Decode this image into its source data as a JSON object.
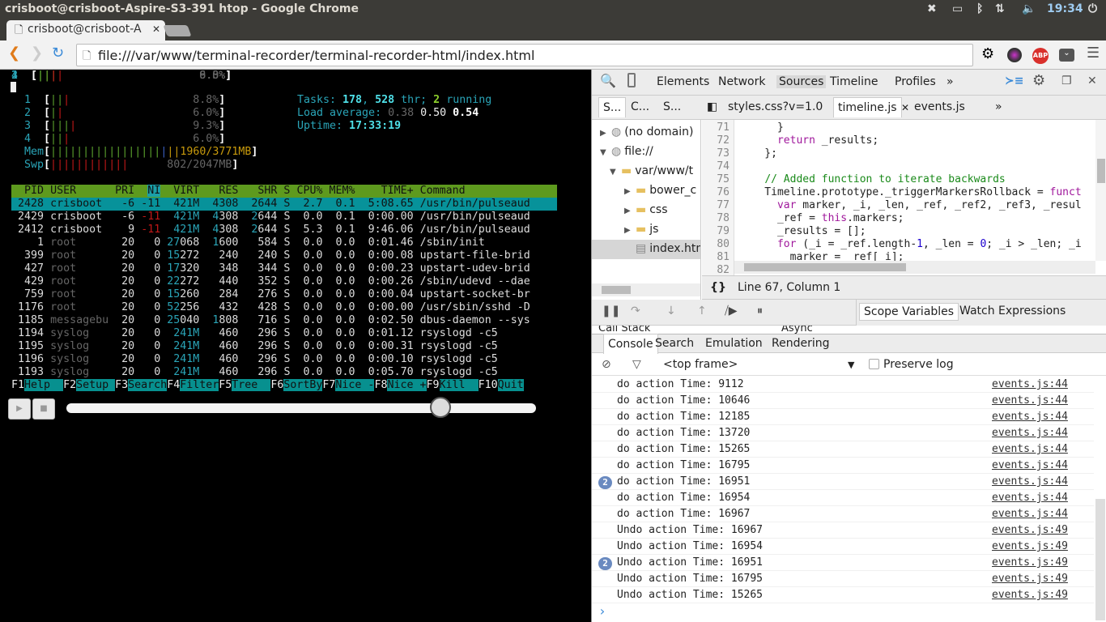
{
  "window": {
    "title": "crisboot@crisboot-Aspire-S3-391 htop - Google Chrome",
    "clock": "19:34"
  },
  "browser": {
    "tab_title": "crisboot@crisboot-A",
    "url": "file:///var/www/terminal-recorder/terminal-recorder-html/index.html",
    "abp": "ABP"
  },
  "htop": {
    "cpus": [
      {
        "label": "1",
        "bars": [
          "gr",
          "gr",
          "rd"
        ],
        "value": "8.8%"
      },
      {
        "label": "2",
        "bars": [
          "gr",
          "rd"
        ],
        "value": "6.0%"
      },
      {
        "label": "3",
        "bars": [
          "gr",
          "gr",
          "gr",
          "rd"
        ],
        "value": "9.3%"
      },
      {
        "label": "4",
        "bars": [
          "gr",
          "gr",
          "rd"
        ],
        "value": "6.0%"
      }
    ],
    "mem": {
      "label": "Mem",
      "bars": [
        "gr",
        "gr",
        "gr",
        "gr",
        "gr",
        "gr",
        "gr",
        "gr",
        "gr",
        "gr",
        "gr",
        "gr",
        "gr",
        "gr",
        "gr",
        "gr",
        "gr",
        "bl",
        "yl",
        "yl"
      ],
      "value": "1960/3771MB"
    },
    "swp": {
      "label": "Swp",
      "bars": [
        "rd",
        "rd",
        "rd",
        "rd",
        "rd",
        "rd",
        "rd",
        "rd",
        "rd",
        "rd",
        "rd",
        "rd"
      ],
      "value": "802/2047MB"
    },
    "tasks": {
      "label": "Tasks: ",
      "tasks": "178",
      "thr": "528",
      "thr_label": " thr; ",
      "running": "2",
      "running_label": " running"
    },
    "load": {
      "label": "Load average: ",
      "l1": "0.38",
      "l5": "0.50",
      "l15": "0.54"
    },
    "uptime": {
      "label": "Uptime: ",
      "value": "17:33:19"
    },
    "columns": [
      "PID",
      "USER",
      "PRI",
      "NI",
      "VIRT",
      "RES",
      "SHR",
      "S",
      "CPU%",
      "MEM%",
      "TIME+",
      "Command"
    ],
    "processes": [
      [
        "2428",
        "crisboot",
        "-6",
        "-11",
        "421M",
        "4308",
        "2644",
        "S",
        "2.7",
        "0.1",
        "5:08.65",
        "/usr/bin/pulseaud"
      ],
      [
        "2429",
        "crisboot",
        "-6",
        "-11",
        "421M",
        "4308",
        "2644",
        "S",
        "0.0",
        "0.1",
        "0:00.00",
        "/usr/bin/pulseaud"
      ],
      [
        "2412",
        "crisboot",
        "9",
        "-11",
        "421M",
        "4308",
        "2644",
        "S",
        "5.3",
        "0.1",
        "9:46.06",
        "/usr/bin/pulseaud"
      ],
      [
        "1",
        "root",
        "20",
        "0",
        "27068",
        "1600",
        "584",
        "S",
        "0.0",
        "0.0",
        "0:01.46",
        "/sbin/init"
      ],
      [
        "399",
        "root",
        "20",
        "0",
        "15272",
        "240",
        "240",
        "S",
        "0.0",
        "0.0",
        "0:00.08",
        "upstart-file-brid"
      ],
      [
        "427",
        "root",
        "20",
        "0",
        "17320",
        "348",
        "344",
        "S",
        "0.0",
        "0.0",
        "0:00.23",
        "upstart-udev-brid"
      ],
      [
        "429",
        "root",
        "20",
        "0",
        "22272",
        "440",
        "352",
        "S",
        "0.0",
        "0.0",
        "0:00.26",
        "/sbin/udevd --dae"
      ],
      [
        "759",
        "root",
        "20",
        "0",
        "15260",
        "284",
        "276",
        "S",
        "0.0",
        "0.0",
        "0:00.04",
        "upstart-socket-br"
      ],
      [
        "1176",
        "root",
        "20",
        "0",
        "52256",
        "432",
        "428",
        "S",
        "0.0",
        "0.0",
        "0:00.00",
        "/usr/sbin/sshd -D"
      ],
      [
        "1185",
        "messagebu",
        "20",
        "0",
        "25040",
        "1808",
        "716",
        "S",
        "0.0",
        "0.0",
        "0:02.50",
        "dbus-daemon --sys"
      ],
      [
        "1194",
        "syslog",
        "20",
        "0",
        "241M",
        "460",
        "296",
        "S",
        "0.0",
        "0.0",
        "0:01.12",
        "rsyslogd -c5"
      ],
      [
        "1195",
        "syslog",
        "20",
        "0",
        "241M",
        "460",
        "296",
        "S",
        "0.0",
        "0.0",
        "0:00.31",
        "rsyslogd -c5"
      ],
      [
        "1196",
        "syslog",
        "20",
        "0",
        "241M",
        "460",
        "296",
        "S",
        "0.0",
        "0.0",
        "0:00.10",
        "rsyslogd -c5"
      ],
      [
        "1193",
        "syslog",
        "20",
        "0",
        "241M",
        "460",
        "296",
        "S",
        "0.0",
        "0.0",
        "0:05.70",
        "rsyslogd -c5"
      ]
    ],
    "selected_row": 0,
    "fkeys": [
      [
        "F1",
        "Help  "
      ],
      [
        "F2",
        "Setup "
      ],
      [
        "F3",
        "Search"
      ],
      [
        "F4",
        "Filter"
      ],
      [
        "F5",
        "Tree  "
      ],
      [
        "F6",
        "SortBy"
      ],
      [
        "F7",
        "Nice -"
      ],
      [
        "F8",
        "Nice +"
      ],
      [
        "F9",
        "Kill  "
      ],
      [
        "F10",
        "Quit"
      ]
    ]
  },
  "player": {
    "play": "▶",
    "stop": "■",
    "progress_percent": 81
  },
  "devtools": {
    "tabs": [
      "Elements",
      "Network",
      "Sources",
      "Timeline",
      "Profiles",
      "»"
    ],
    "active_tab": "Sources",
    "nav_tabs": [
      "S...",
      "C...",
      "S..."
    ],
    "file_tabs": [
      "styles.css?v=1.0",
      "timeline.js",
      "events.js",
      "»"
    ],
    "tree": [
      "(no domain)",
      "file://",
      "var/www/t",
      "bower_c",
      "css",
      "js",
      "index.htm"
    ],
    "code": [
      {
        "n": "71",
        "h": "      }"
      },
      {
        "n": "72",
        "h": "      <span class='kw'>return</span> _results;"
      },
      {
        "n": "73",
        "h": "    };"
      },
      {
        "n": "74",
        "h": ""
      },
      {
        "n": "75",
        "h": "    <span class='cm'>// Added function to iterate backwards</span>"
      },
      {
        "n": "76",
        "h": "    Timeline.prototype._triggerMarkersRollback = <span class='kw'>funct</span>"
      },
      {
        "n": "77",
        "h": "      <span class='kw'>var</span> marker, _i, _len, _ref, _ref2, _ref3, _resul"
      },
      {
        "n": "78",
        "h": "      _ref = <span class='kw'>this</span>.markers;"
      },
      {
        "n": "79",
        "h": "      _results = [];"
      },
      {
        "n": "80",
        "h": "      <span class='kw'>for</span> (_i = _ref.length-<span class='nm'>1</span>, _len = <span class='nm'>0</span>; _i &gt; _len; _i"
      },
      {
        "n": "81",
        "h": "        marker = _ref[_i];"
      },
      {
        "n": "82",
        "h": ""
      }
    ],
    "status": "Line 67, Column 1",
    "call_stack": "Call Stack",
    "async": "Async",
    "scope_tabs": [
      "Scope Variables",
      "Watch Expressions"
    ],
    "drawer_tabs": [
      "Console",
      "Search",
      "Emulation",
      "Rendering"
    ],
    "frame": "<top frame>",
    "preserve_log": "Preserve log",
    "console": [
      {
        "msg": "do action Time: 9112",
        "src": "events.js:44"
      },
      {
        "msg": "do action Time: 10646",
        "src": "events.js:44"
      },
      {
        "msg": "do action Time: 12185",
        "src": "events.js:44"
      },
      {
        "msg": "do action Time: 13720",
        "src": "events.js:44"
      },
      {
        "msg": "do action Time: 15265",
        "src": "events.js:44"
      },
      {
        "msg": "do action Time: 16795",
        "src": "events.js:44"
      },
      {
        "msg": "do action Time: 16951",
        "src": "events.js:44",
        "count": "2"
      },
      {
        "msg": "do action Time: 16954",
        "src": "events.js:44"
      },
      {
        "msg": "do action Time: 16967",
        "src": "events.js:44"
      },
      {
        "msg": "Undo action Time: 16967",
        "src": "events.js:49"
      },
      {
        "msg": "Undo action Time: 16954",
        "src": "events.js:49"
      },
      {
        "msg": "Undo action Time: 16951",
        "src": "events.js:49",
        "count": "2"
      },
      {
        "msg": "Undo action Time: 16795",
        "src": "events.js:49"
      },
      {
        "msg": "Undo action Time: 15265",
        "src": "events.js:49"
      }
    ],
    "prompt": "›"
  }
}
